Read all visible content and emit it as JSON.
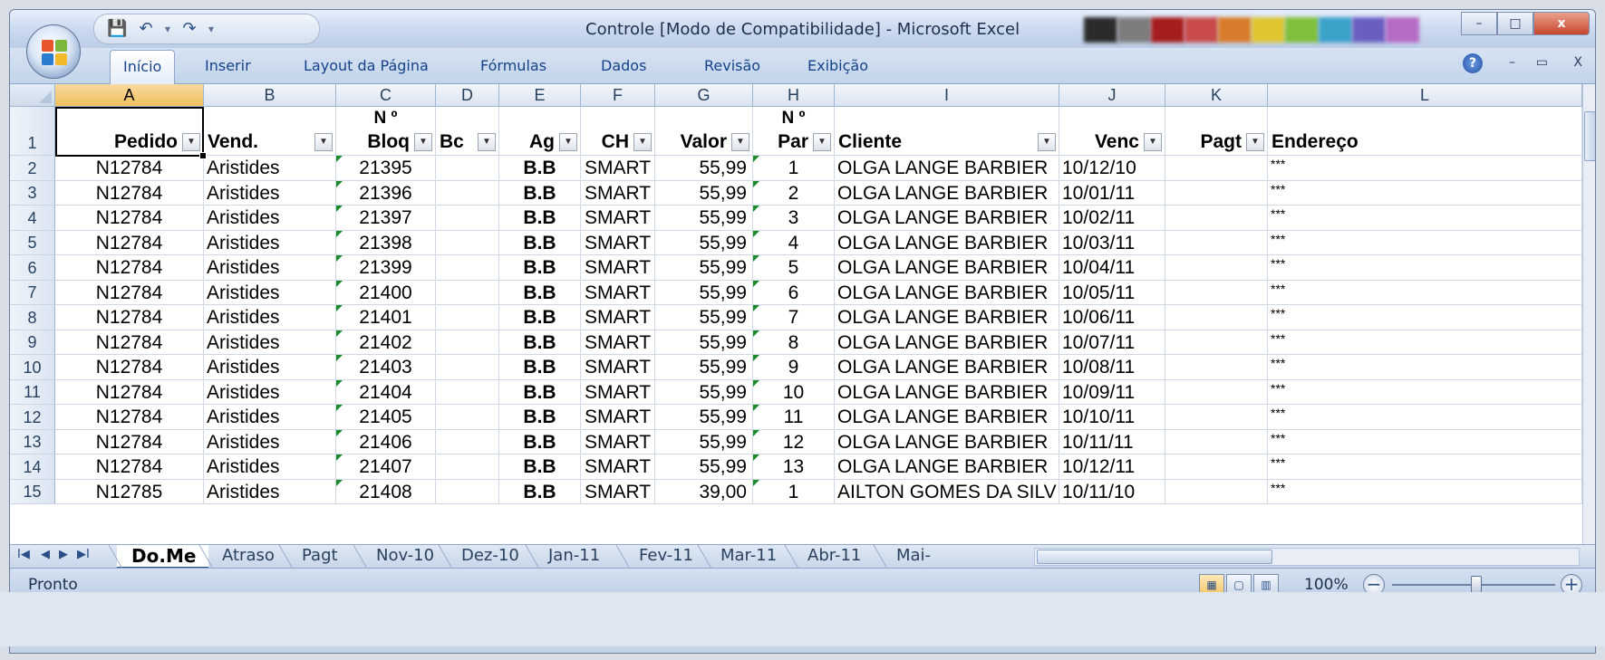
{
  "window": {
    "title": "Controle  [Modo de Compatibilidade] - Microsoft Excel",
    "minimize": "–",
    "maximize": "□",
    "close": "x"
  },
  "qat": {
    "save": "💾",
    "undo": "↶",
    "redo": "↷",
    "customize": "▾"
  },
  "ribbon": {
    "tabs": [
      "Início",
      "Inserir",
      "Layout da Página",
      "Fórmulas",
      "Dados",
      "Revisão",
      "Exibição"
    ],
    "active_tab": "Início",
    "help": "?",
    "min": "–",
    "restore": "▭",
    "close": "X"
  },
  "columns": [
    "A",
    "B",
    "C",
    "D",
    "E",
    "F",
    "G",
    "H",
    "I",
    "J",
    "K",
    "L"
  ],
  "selected_column": "A",
  "header_row": {
    "row_number": "1",
    "pedido": "Pedido",
    "vend": "Vend.",
    "bloq_top": "N º",
    "bloq": "Bloq",
    "bc": "Bc",
    "ag": "Ag",
    "ch": "CH",
    "valor": "Valor",
    "par_top": "N º",
    "par": "Par",
    "cliente": "Cliente",
    "venc": "Venc",
    "pagt": "Pagt",
    "endereco": "Endereço"
  },
  "rows": [
    {
      "n": "2",
      "pedido": "N12784",
      "vend": "Aristides",
      "bloq": "21395",
      "bc": "",
      "ag": "B.B",
      "ch": "SMART",
      "valor": "55,99",
      "par": "1",
      "cliente": "OLGA LANGE BARBIER",
      "venc": "10/12/10",
      "pagt": "",
      "endereco": "***"
    },
    {
      "n": "3",
      "pedido": "N12784",
      "vend": "Aristides",
      "bloq": "21396",
      "bc": "",
      "ag": "B.B",
      "ch": "SMART",
      "valor": "55,99",
      "par": "2",
      "cliente": "OLGA LANGE BARBIER",
      "venc": "10/01/11",
      "pagt": "",
      "endereco": "***"
    },
    {
      "n": "4",
      "pedido": "N12784",
      "vend": "Aristides",
      "bloq": "21397",
      "bc": "",
      "ag": "B.B",
      "ch": "SMART",
      "valor": "55,99",
      "par": "3",
      "cliente": "OLGA LANGE BARBIER",
      "venc": "10/02/11",
      "pagt": "",
      "endereco": "***"
    },
    {
      "n": "5",
      "pedido": "N12784",
      "vend": "Aristides",
      "bloq": "21398",
      "bc": "",
      "ag": "B.B",
      "ch": "SMART",
      "valor": "55,99",
      "par": "4",
      "cliente": "OLGA LANGE BARBIER",
      "venc": "10/03/11",
      "pagt": "",
      "endereco": "***"
    },
    {
      "n": "6",
      "pedido": "N12784",
      "vend": "Aristides",
      "bloq": "21399",
      "bc": "",
      "ag": "B.B",
      "ch": "SMART",
      "valor": "55,99",
      "par": "5",
      "cliente": "OLGA LANGE BARBIER",
      "venc": "10/04/11",
      "pagt": "",
      "endereco": "***"
    },
    {
      "n": "7",
      "pedido": "N12784",
      "vend": "Aristides",
      "bloq": "21400",
      "bc": "",
      "ag": "B.B",
      "ch": "SMART",
      "valor": "55,99",
      "par": "6",
      "cliente": "OLGA LANGE BARBIER",
      "venc": "10/05/11",
      "pagt": "",
      "endereco": "***"
    },
    {
      "n": "8",
      "pedido": "N12784",
      "vend": "Aristides",
      "bloq": "21401",
      "bc": "",
      "ag": "B.B",
      "ch": "SMART",
      "valor": "55,99",
      "par": "7",
      "cliente": "OLGA LANGE BARBIER",
      "venc": "10/06/11",
      "pagt": "",
      "endereco": "***"
    },
    {
      "n": "9",
      "pedido": "N12784",
      "vend": "Aristides",
      "bloq": "21402",
      "bc": "",
      "ag": "B.B",
      "ch": "SMART",
      "valor": "55,99",
      "par": "8",
      "cliente": "OLGA LANGE BARBIER",
      "venc": "10/07/11",
      "pagt": "",
      "endereco": "***"
    },
    {
      "n": "10",
      "pedido": "N12784",
      "vend": "Aristides",
      "bloq": "21403",
      "bc": "",
      "ag": "B.B",
      "ch": "SMART",
      "valor": "55,99",
      "par": "9",
      "cliente": "OLGA LANGE BARBIER",
      "venc": "10/08/11",
      "pagt": "",
      "endereco": "***"
    },
    {
      "n": "11",
      "pedido": "N12784",
      "vend": "Aristides",
      "bloq": "21404",
      "bc": "",
      "ag": "B.B",
      "ch": "SMART",
      "valor": "55,99",
      "par": "10",
      "cliente": "OLGA LANGE BARBIER",
      "venc": "10/09/11",
      "pagt": "",
      "endereco": "***"
    },
    {
      "n": "12",
      "pedido": "N12784",
      "vend": "Aristides",
      "bloq": "21405",
      "bc": "",
      "ag": "B.B",
      "ch": "SMART",
      "valor": "55,99",
      "par": "11",
      "cliente": "OLGA LANGE BARBIER",
      "venc": "10/10/11",
      "pagt": "",
      "endereco": "***"
    },
    {
      "n": "13",
      "pedido": "N12784",
      "vend": "Aristides",
      "bloq": "21406",
      "bc": "",
      "ag": "B.B",
      "ch": "SMART",
      "valor": "55,99",
      "par": "12",
      "cliente": "OLGA LANGE BARBIER",
      "venc": "10/11/11",
      "pagt": "",
      "endereco": "***"
    },
    {
      "n": "14",
      "pedido": "N12784",
      "vend": "Aristides",
      "bloq": "21407",
      "bc": "",
      "ag": "B.B",
      "ch": "SMART",
      "valor": "55,99",
      "par": "13",
      "cliente": "OLGA LANGE BARBIER",
      "venc": "10/12/11",
      "pagt": "",
      "endereco": "***"
    },
    {
      "n": "15",
      "pedido": "N12785",
      "vend": "Aristides",
      "bloq": "21408",
      "bc": "",
      "ag": "B.B",
      "ch": "SMART",
      "valor": "39,00",
      "par": "1",
      "cliente": "AILTON GOMES DA SILV",
      "venc": "10/11/10",
      "pagt": "",
      "endereco": "***"
    }
  ],
  "sheet_nav": {
    "first": "I◀",
    "prev": "◀",
    "next": "▶",
    "last": "▶I"
  },
  "sheets": [
    "Do.Me",
    "Atraso",
    "Pagt",
    "Nov-10",
    "Dez-10",
    "Jan-11",
    "Fev-11",
    "Mar-11",
    "Abr-11",
    "Mai-"
  ],
  "active_sheet": "Do.Me",
  "status": {
    "text": "Pronto",
    "zoom": "100%",
    "zoom_out": "−",
    "zoom_in": "+"
  },
  "colors": {
    "accent": "#15428b",
    "selected_header": "#f1c15f",
    "chrome": "#c5d3e6"
  }
}
